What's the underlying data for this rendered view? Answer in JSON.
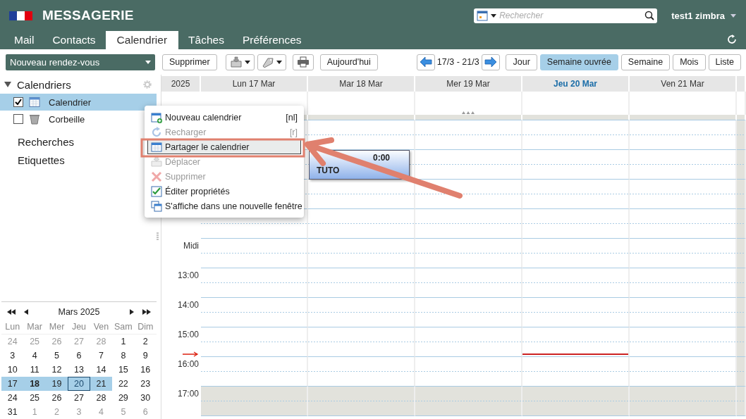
{
  "header": {
    "title": "MESSAGERIE",
    "search": {
      "placeholder": "Rechercher"
    },
    "user": "test1 zimbra"
  },
  "tabs": [
    {
      "label": "Mail",
      "selected": false
    },
    {
      "label": "Contacts",
      "selected": false
    },
    {
      "label": "Calendrier",
      "selected": true
    },
    {
      "label": "Tâches",
      "selected": false
    },
    {
      "label": "Préférences",
      "selected": false
    }
  ],
  "toolbar": {
    "new_button": "Nouveau rendez-vous",
    "delete_button": "Supprimer",
    "today_button": "Aujourd'hui",
    "range": "17/3 - 21/3",
    "views": [
      {
        "label": "Jour",
        "selected": false
      },
      {
        "label": "Semaine ouvrée",
        "selected": true
      },
      {
        "label": "Semaine",
        "selected": false
      },
      {
        "label": "Mois",
        "selected": false
      },
      {
        "label": "Liste",
        "selected": false
      }
    ]
  },
  "sidebar": {
    "heading": "Calendriers",
    "expanded": true,
    "calendars": [
      {
        "label": "Calendrier",
        "kind": "calendar",
        "checked": true,
        "selected": true
      },
      {
        "label": "Corbeille",
        "kind": "trash",
        "checked": false,
        "selected": false
      }
    ],
    "sections": [
      "Recherches",
      "Etiquettes"
    ]
  },
  "mini_calendar": {
    "title": "Mars 2025",
    "weekdays": [
      "Lun",
      "Mar",
      "Mer",
      "Jeu",
      "Ven",
      "Sam",
      "Dim"
    ],
    "weeks": [
      [
        {
          "day": "24",
          "outside": true
        },
        {
          "day": "25",
          "outside": true
        },
        {
          "day": "26",
          "outside": true
        },
        {
          "day": "27",
          "outside": true
        },
        {
          "day": "28",
          "outside": true
        },
        {
          "day": "1",
          "outside": false
        },
        {
          "day": "2",
          "outside": false
        }
      ],
      [
        {
          "day": "3",
          "outside": false
        },
        {
          "day": "4",
          "outside": false
        },
        {
          "day": "5",
          "outside": false
        },
        {
          "day": "6",
          "outside": false
        },
        {
          "day": "7",
          "outside": false
        },
        {
          "day": "8",
          "outside": false
        },
        {
          "day": "9",
          "outside": false
        }
      ],
      [
        {
          "day": "10",
          "outside": false
        },
        {
          "day": "11",
          "outside": false
        },
        {
          "day": "12",
          "outside": false
        },
        {
          "day": "13",
          "outside": false
        },
        {
          "day": "14",
          "outside": false
        },
        {
          "day": "15",
          "outside": false
        },
        {
          "day": "16",
          "outside": false
        }
      ],
      [
        {
          "day": "17",
          "outside": false,
          "selected": true
        },
        {
          "day": "18",
          "outside": false,
          "selected": true,
          "has_appointment": true
        },
        {
          "day": "19",
          "outside": false,
          "selected": true
        },
        {
          "day": "20",
          "outside": false,
          "selected": true,
          "today": true
        },
        {
          "day": "21",
          "outside": false,
          "selected": true
        },
        {
          "day": "22",
          "outside": false
        },
        {
          "day": "23",
          "outside": false
        }
      ],
      [
        {
          "day": "24",
          "outside": false
        },
        {
          "day": "25",
          "outside": false
        },
        {
          "day": "26",
          "outside": false
        },
        {
          "day": "27",
          "outside": false
        },
        {
          "day": "28",
          "outside": false
        },
        {
          "day": "29",
          "outside": false
        },
        {
          "day": "30",
          "outside": false
        }
      ],
      [
        {
          "day": "31",
          "outside": false
        },
        {
          "day": "1",
          "outside": true
        },
        {
          "day": "2",
          "outside": true
        },
        {
          "day": "3",
          "outside": true
        },
        {
          "day": "4",
          "outside": true
        },
        {
          "day": "5",
          "outside": true
        },
        {
          "day": "6",
          "outside": true
        }
      ]
    ]
  },
  "calendar": {
    "year": "2025",
    "days": [
      {
        "label": "Lun 17 Mar",
        "today": false
      },
      {
        "label": "Mar 18 Mar",
        "today": false,
        "events": [
          {
            "time": "0:00",
            "title": "TUTO"
          }
        ]
      },
      {
        "label": "Mer 19 Mar",
        "today": false
      },
      {
        "label": "Jeu 20 Mar",
        "today": true
      },
      {
        "label": "Ven 21 Mar",
        "today": false
      }
    ],
    "rows": [
      {
        "off_hours": false,
        "now": false
      },
      {
        "off_hours": false,
        "now": false,
        "has_event": true
      },
      {
        "off_hours": false,
        "now": false
      },
      {
        "off_hours": false,
        "now": false
      },
      {
        "label": "Midi",
        "off_hours": false,
        "now": false
      },
      {
        "label": "13:00",
        "off_hours": false,
        "now": false
      },
      {
        "label": "14:00",
        "off_hours": false,
        "now": false
      },
      {
        "label": "15:00",
        "off_hours": false,
        "now": true
      },
      {
        "label": "16:00",
        "off_hours": false,
        "now": false
      },
      {
        "label": "17:00",
        "off_hours": true,
        "now": false
      }
    ]
  },
  "context_menu": {
    "items": [
      {
        "label": "Nouveau calendrier",
        "shortcut": "[nl]",
        "kind": "new",
        "disabled": false,
        "selected": false
      },
      {
        "label": "Recharger",
        "shortcut": "[r]",
        "kind": "reload",
        "disabled": true,
        "selected": false
      },
      {
        "label": "Partager le calendrier",
        "kind": "share",
        "disabled": false,
        "selected": true
      },
      {
        "label": "Déplacer",
        "kind": "move",
        "disabled": true,
        "selected": false
      },
      {
        "label": "Supprimer",
        "kind": "delete",
        "disabled": true,
        "selected": false
      },
      {
        "label": "Éditer propriétés",
        "kind": "edit",
        "disabled": false,
        "selected": false
      },
      {
        "label": "S'affiche dans une nouvelle fenêtre",
        "kind": "window",
        "disabled": false,
        "selected": false
      }
    ]
  }
}
